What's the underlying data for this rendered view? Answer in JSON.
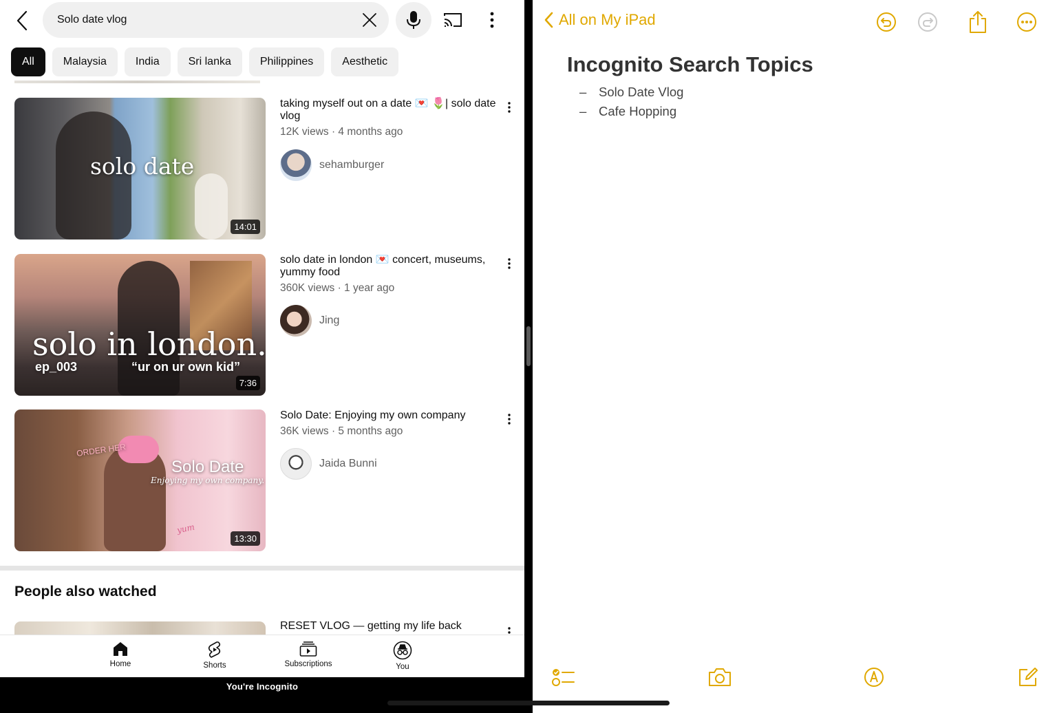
{
  "youtube": {
    "search": {
      "value": "Solo date vlog"
    },
    "chips": [
      "All",
      "Malaysia",
      "India",
      "Sri lanka",
      "Philippines",
      "Aesthetic"
    ],
    "videos": [
      {
        "title": "taking myself out on a date 💌 🌷| solo date vlog",
        "meta": "12K views · 4 months ago",
        "channel": "sehamburger",
        "duration": "14:01",
        "thumb_text": "solo date"
      },
      {
        "title": "solo date in london 💌 concert, museums, yummy food",
        "meta": "360K views · 1 year ago",
        "channel": "Jing",
        "duration": "7:36",
        "thumb_text": "solo in london.",
        "thumb_sub_left": "ep_003",
        "thumb_sub_right": "“ur on ur own kid”"
      },
      {
        "title": "Solo Date: Enjoying my own company",
        "meta": "36K views · 5 months ago",
        "channel": "Jaida Bunni",
        "duration": "13:30",
        "thumb_text": "Solo Date",
        "thumb_sub": "Enjoying my own company.",
        "thumb_sign": "ORDER HER",
        "thumb_box": "yum"
      }
    ],
    "section_title": "People also watched",
    "peek_title": "RESET VLOG — getting my life back",
    "nav": {
      "home": "Home",
      "shorts": "Shorts",
      "subscriptions": "Subscriptions",
      "you": "You"
    },
    "incognito": "You're Incognito"
  },
  "notes": {
    "back_label": "All on My iPad",
    "title": "Incognito Search Topics",
    "items": [
      "Solo Date Vlog",
      "Cafe Hopping"
    ],
    "accent": "#E0A800"
  }
}
